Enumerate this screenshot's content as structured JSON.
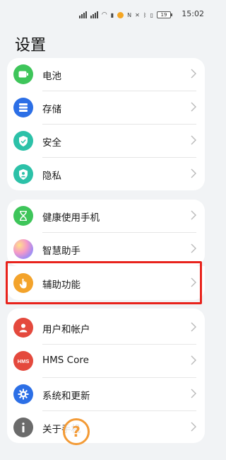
{
  "status_bar": {
    "time": "15:02",
    "battery_level": "19",
    "network_label": "HD"
  },
  "page": {
    "title": "设置"
  },
  "groups": [
    {
      "items": [
        {
          "label": "电池",
          "icon": "battery-icon",
          "color": "#3ec55a"
        },
        {
          "label": "存储",
          "icon": "storage-icon",
          "color": "#2c6fe6"
        },
        {
          "label": "安全",
          "icon": "shield-icon",
          "color": "#2cc1a8"
        },
        {
          "label": "隐私",
          "icon": "privacy-icon",
          "color": "#2cc1a8"
        }
      ]
    },
    {
      "items": [
        {
          "label": "健康使用手机",
          "icon": "hourglass-icon",
          "color": "#3ec55a"
        },
        {
          "label": "智慧助手",
          "icon": "assistant-orb-icon",
          "color": "#b98be8"
        }
      ]
    },
    {
      "items": [
        {
          "label": "辅助功能",
          "icon": "hand-pointer-icon",
          "color": "#f3a32b"
        }
      ]
    },
    {
      "items": [
        {
          "label": "用户和帐户",
          "icon": "user-icon",
          "color": "#e4493d"
        },
        {
          "label": "HMS Core",
          "icon": "hms-core-icon",
          "color": "#e4493d",
          "icon_text": "HMS"
        },
        {
          "label": "系统和更新",
          "icon": "gear-icon",
          "color": "#2c6fe6"
        },
        {
          "label": "关于手机",
          "icon": "info-icon",
          "color": "#6b6b6b"
        }
      ]
    }
  ],
  "overlay": {
    "help_symbol": "?"
  },
  "colors": {
    "highlight": "#e8231c",
    "help_badge": "#f39a35"
  }
}
